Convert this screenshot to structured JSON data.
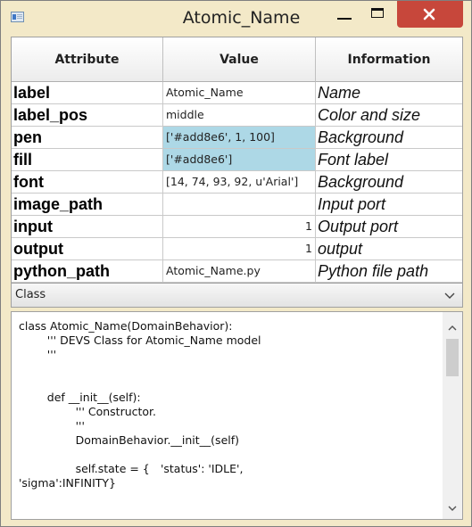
{
  "window": {
    "title": "Atomic_Name"
  },
  "grid": {
    "headers": [
      "Attribute",
      "Value",
      "Information"
    ],
    "rows": [
      {
        "attr": "label",
        "value": "Atomic_Name",
        "info": "Name",
        "align": "left",
        "highlight": false
      },
      {
        "attr": "label_pos",
        "value": "middle",
        "info": "Color and size",
        "align": "left",
        "highlight": false
      },
      {
        "attr": "pen",
        "value": "['#add8e6', 1, 100]",
        "info": "Background",
        "align": "left",
        "highlight": true
      },
      {
        "attr": "fill",
        "value": "['#add8e6']",
        "info": "Font label",
        "align": "left",
        "highlight": true
      },
      {
        "attr": "font",
        "value": "[14, 74, 93, 92, u'Arial']",
        "info": "Background",
        "align": "left",
        "highlight": false
      },
      {
        "attr": "image_path",
        "value": "",
        "info": "Input port",
        "align": "left",
        "highlight": false
      },
      {
        "attr": "input",
        "value": "1",
        "info": "Output port",
        "align": "right",
        "highlight": false
      },
      {
        "attr": "output",
        "value": "1",
        "info": "output",
        "align": "right",
        "highlight": false
      },
      {
        "attr": "python_path",
        "value": "Atomic_Name.py",
        "info": "Python file path",
        "align": "left",
        "highlight": false
      }
    ],
    "highlight_color": "#add8e6"
  },
  "class_selector": {
    "selected": "Class"
  },
  "code": {
    "text": "class Atomic_Name(DomainBehavior):\n\t''' DEVS Class for Atomic_Name model\n\t'''\n\n\n\tdef __init__(self):\n\t\t''' Constructor.\n\t\t'''\n\t\tDomainBehavior.__init__(self)\n\n\t\tself.state = {\t'status': 'IDLE',\n'sigma':INFINITY}"
  },
  "colors": {
    "close_button": "#c7473b",
    "window_frame": "#f3e9c8"
  },
  "icons": [
    "window-app-icon",
    "minimize-icon",
    "maximize-icon",
    "close-icon",
    "chevron-down-icon",
    "scroll-up-icon",
    "scroll-down-icon"
  ]
}
